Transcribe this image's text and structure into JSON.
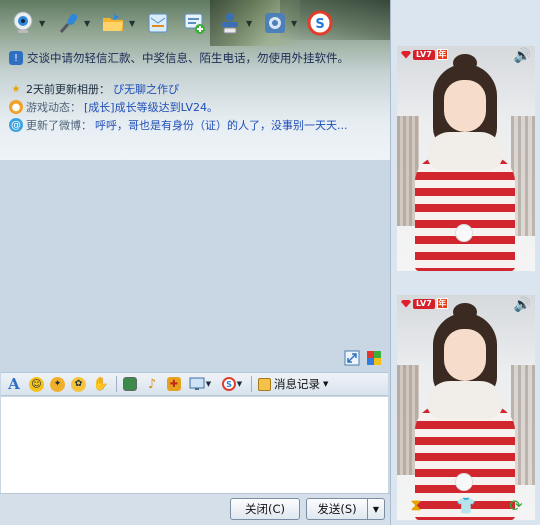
{
  "toolbar": {
    "items": [
      {
        "name": "video-call",
        "icon": "webcam-icon"
      },
      {
        "name": "voice-call",
        "icon": "microphone-icon"
      },
      {
        "name": "send-file",
        "icon": "folder-icon"
      },
      {
        "name": "send-sms",
        "icon": "sms-icon"
      },
      {
        "name": "create-group",
        "icon": "add-chat-icon"
      },
      {
        "name": "remote-assist",
        "icon": "remote-icon"
      },
      {
        "name": "apps",
        "icon": "app-box-icon"
      },
      {
        "name": "sogou",
        "icon": "sogou-icon"
      }
    ]
  },
  "chat": {
    "notice": "交谈中请勿轻信汇款、中奖信息、陌生电话，勿使用外挂软件。",
    "album_prefix": "2天前更新相册：",
    "album_link": "ぴ无聊之作ぴ",
    "game_prefix": "游戏动态：",
    "game_link": "[成长]成长等级达到LV24。",
    "weibo_prefix": "更新了微博：",
    "weibo_link": "呼呼，哥也是有身份（证）的人了，没事别一天天..."
  },
  "format_bar": {
    "history_label": "消息记录"
  },
  "buttons": {
    "close": "关闭(C)",
    "send": "发送(S)"
  },
  "profile": {
    "level_badge": "LV7",
    "year_badge": "年"
  },
  "colors": {
    "link": "#1f4fb8",
    "notice": "#1a2b55",
    "badge_red": "#d5202a"
  }
}
